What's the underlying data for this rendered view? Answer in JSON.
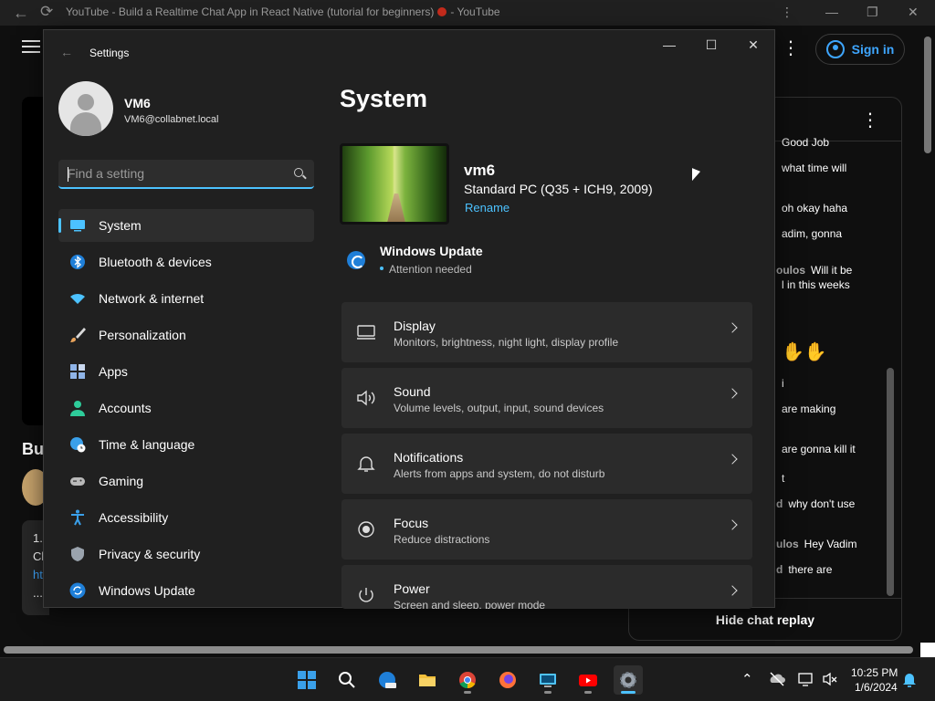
{
  "browser": {
    "tab_title": "YouTube - Build a Realtime Chat App in React Native (tutorial for beginners)",
    "tab_suffix": "- YouTube",
    "back_icon": "arrow-left-icon",
    "reload_icon": "reload-icon"
  },
  "youtube": {
    "sign_in_label": "Sign in",
    "video_title_fragment": "Bu",
    "card_lines": [
      "1.",
      "Cl",
      "ht",
      "..."
    ],
    "chat_messages": [
      {
        "author": "",
        "text": "Good Job"
      },
      {
        "author": "",
        "text": "what time will"
      },
      {
        "author": "",
        "text": "oh okay haha"
      },
      {
        "author": "",
        "text": "adim, gonna"
      },
      {
        "author": "oulos",
        "text": "Will it be"
      },
      {
        "author": "",
        "text": "l in this weeks"
      },
      {
        "author": "",
        "text": "✋✋"
      },
      {
        "author": "",
        "text": "i"
      },
      {
        "author": "",
        "text": "are making"
      },
      {
        "author": "",
        "text": "are gonna kill it"
      },
      {
        "author": "",
        "text": "t"
      },
      {
        "author": "d",
        "text": "why don't use"
      },
      {
        "author": "ulos",
        "text": "Hey Vadim"
      },
      {
        "author": "d",
        "text": "there are"
      }
    ],
    "hide_chat_label": "Hide chat replay"
  },
  "settings": {
    "window_title": "Settings",
    "user": {
      "name": "VM6",
      "email": "VM6@collabnet.local"
    },
    "search": {
      "placeholder": "Find a setting",
      "value": ""
    },
    "nav": [
      {
        "label": "System",
        "icon": "monitor-icon",
        "active": true,
        "color": "#4cc2ff"
      },
      {
        "label": "Bluetooth & devices",
        "icon": "bluetooth-icon",
        "color": "#1f7fd8"
      },
      {
        "label": "Network & internet",
        "icon": "wifi-icon",
        "color": "#4cc2ff"
      },
      {
        "label": "Personalization",
        "icon": "brush-icon",
        "color": "#e8a35b"
      },
      {
        "label": "Apps",
        "icon": "apps-icon",
        "color": "#8fb4e8"
      },
      {
        "label": "Accounts",
        "icon": "person-icon",
        "color": "#2ecc9a"
      },
      {
        "label": "Time & language",
        "icon": "globe-clock-icon",
        "color": "#3aa0ea"
      },
      {
        "label": "Gaming",
        "icon": "gamepad-icon",
        "color": "#b9b9b9"
      },
      {
        "label": "Accessibility",
        "icon": "accessibility-icon",
        "color": "#3aa0ea"
      },
      {
        "label": "Privacy & security",
        "icon": "shield-icon",
        "color": "#9aa3ad"
      },
      {
        "label": "Windows Update",
        "icon": "update-icon",
        "color": "#1f7fd8"
      }
    ],
    "page_title": "System",
    "device": {
      "name": "vm6",
      "model": "Standard PC (Q35 + ICH9, 2009)",
      "rename_label": "Rename"
    },
    "windows_update": {
      "title": "Windows Update",
      "status": "Attention needed"
    },
    "cards": [
      {
        "title": "Display",
        "subtitle": "Monitors, brightness, night light, display profile",
        "icon": "display-icon"
      },
      {
        "title": "Sound",
        "subtitle": "Volume levels, output, input, sound devices",
        "icon": "speaker-icon"
      },
      {
        "title": "Notifications",
        "subtitle": "Alerts from apps and system, do not disturb",
        "icon": "bell-icon"
      },
      {
        "title": "Focus",
        "subtitle": "Reduce distractions",
        "icon": "focus-icon"
      },
      {
        "title": "Power",
        "subtitle": "Screen and sleep, power mode",
        "icon": "power-icon"
      }
    ]
  },
  "taskbar": {
    "apps": [
      {
        "name": "start",
        "color": "#3aa0ea"
      },
      {
        "name": "search",
        "color": "#ffffff"
      },
      {
        "name": "edge-beta",
        "color": "#1f7fd8"
      },
      {
        "name": "file-explorer",
        "color": "#f3c03b"
      },
      {
        "name": "chrome",
        "color": "#db4437"
      },
      {
        "name": "firefox",
        "color": "#ff7139"
      },
      {
        "name": "remote-desktop",
        "color": "#4fc3f7"
      },
      {
        "name": "youtube",
        "color": "#ff0000"
      },
      {
        "name": "settings",
        "color": "#9aa3ad",
        "active": true
      }
    ],
    "time": "10:25 PM",
    "date": "1/6/2024"
  }
}
